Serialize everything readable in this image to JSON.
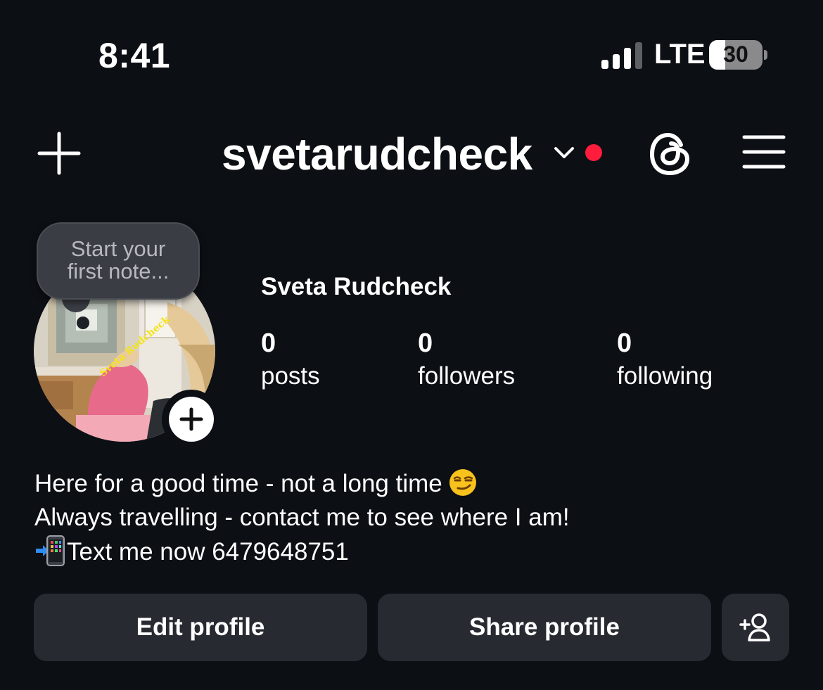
{
  "status_bar": {
    "time": "8:41",
    "network": "LTE",
    "battery": "30",
    "battery_level": 0.3
  },
  "header": {
    "username": "svetarudcheck",
    "icons": [
      "plus-icon",
      "chevron-down-icon",
      "notification-dot",
      "threads-icon",
      "menu-icon"
    ]
  },
  "note": {
    "line1": "Start your",
    "line2": "first note..."
  },
  "profile": {
    "full_name": "Sveta Rudcheck",
    "stats": [
      {
        "count": "0",
        "label": "posts"
      },
      {
        "count": "0",
        "label": "followers"
      },
      {
        "count": "0",
        "label": "following"
      }
    ]
  },
  "bio": {
    "line1": "Here for a good time - not a long time",
    "line2": "Always travelling - contact me to see where I am!",
    "line3": "Text me now 6479648751",
    "avatar_watermark": "Sveta Rudcheck"
  },
  "buttons": {
    "edit": "Edit profile",
    "share": "Share profile"
  },
  "colors": {
    "background": "#0c0f14",
    "button": "#272a31",
    "notification": "#ff1d3d"
  }
}
